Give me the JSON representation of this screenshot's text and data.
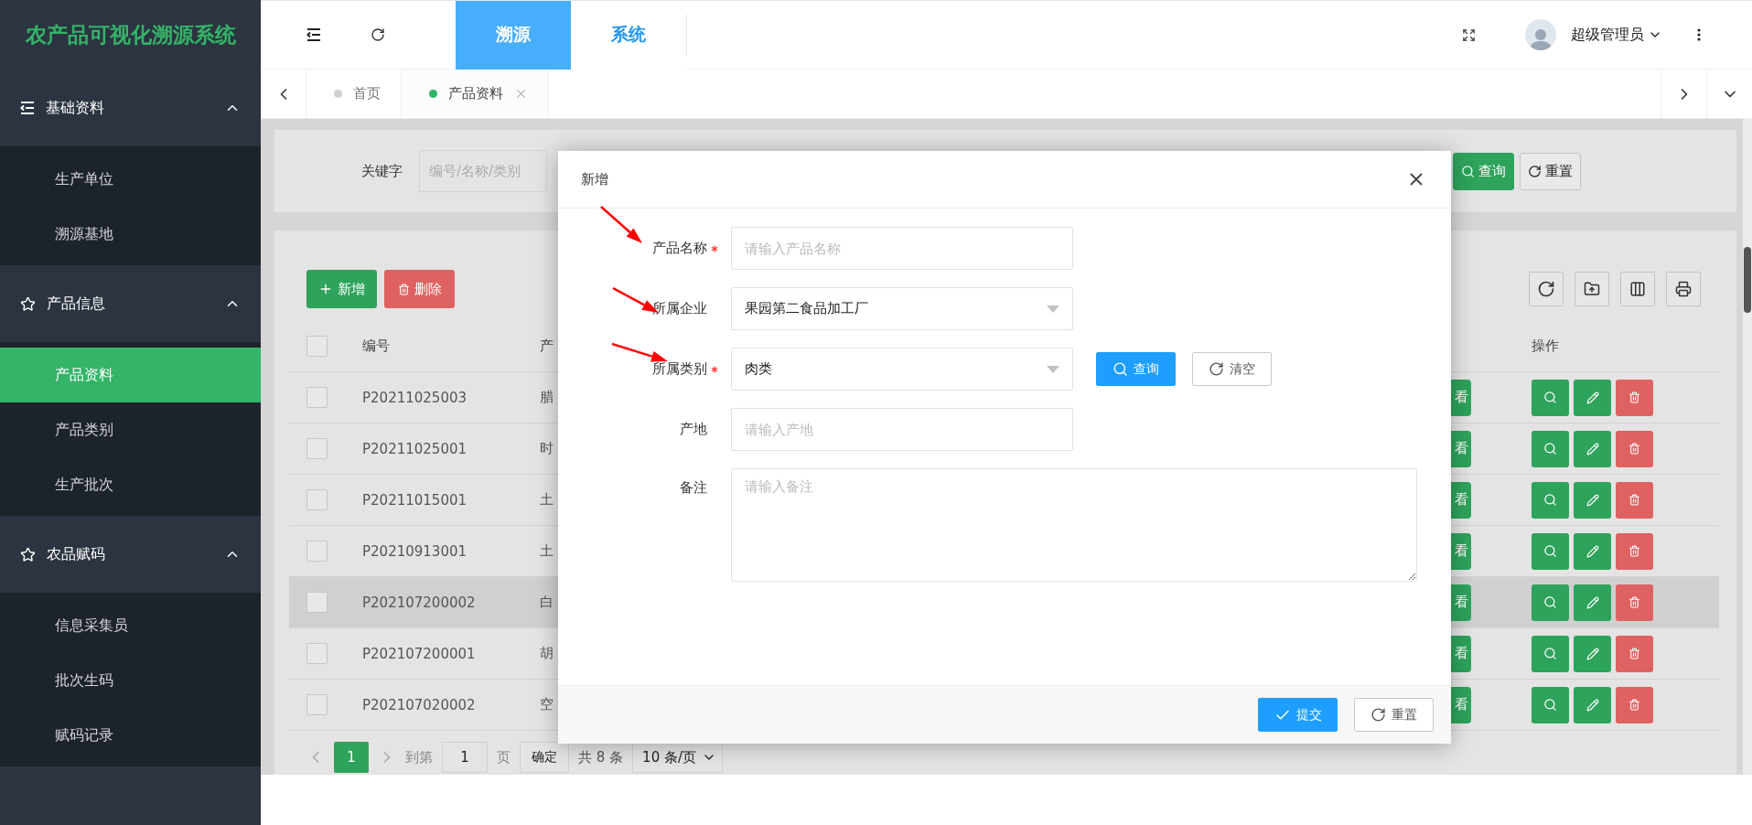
{
  "sidebar": {
    "title": "农产品可视化溯源系统",
    "groups": [
      {
        "label": "基础资料",
        "kind": "list",
        "expanded": true,
        "items": [
          {
            "label": "生产单位",
            "selected": false
          },
          {
            "label": "溯源基地",
            "selected": false
          }
        ]
      },
      {
        "label": "产品信息",
        "kind": "star",
        "expanded": true,
        "items": [
          {
            "label": "产品资料",
            "selected": true
          },
          {
            "label": "产品类别",
            "selected": false
          },
          {
            "label": "生产批次",
            "selected": false
          }
        ]
      },
      {
        "label": "农品赋码",
        "kind": "star",
        "expanded": true,
        "items": [
          {
            "label": "信息采集员",
            "selected": false
          },
          {
            "label": "批次生码",
            "selected": false
          },
          {
            "label": "赋码记录",
            "selected": false
          }
        ]
      }
    ]
  },
  "header": {
    "nav_tabs": [
      {
        "label": "溯源",
        "selected": true
      },
      {
        "label": "系统",
        "selected": false
      }
    ],
    "user": {
      "name": "超级管理员"
    }
  },
  "tabs": [
    {
      "label": "首页",
      "selected": false,
      "closable": false
    },
    {
      "label": "产品资料",
      "selected": true,
      "closable": true
    }
  ],
  "search": {
    "label": "关键字",
    "placeholder": "编号/名称/类别",
    "buttons": [
      {
        "label": "查询",
        "kind": "search"
      },
      {
        "label": "重置",
        "kind": "reset"
      }
    ]
  },
  "toolbar": {
    "buttons": [
      {
        "label": "新增",
        "kind": "add"
      },
      {
        "label": "删除",
        "kind": "delete"
      }
    ]
  },
  "table": {
    "columns": [
      "编号",
      "产",
      "操作"
    ],
    "header_checked": false,
    "rows": [
      {
        "code": "P20211025003",
        "name": "腊",
        "view": "看",
        "checked": false,
        "hovered": false
      },
      {
        "code": "P20211025001",
        "name": "时",
        "view": "看",
        "checked": false,
        "hovered": false
      },
      {
        "code": "P20211015001",
        "name": "土",
        "view": "看",
        "checked": false,
        "hovered": false
      },
      {
        "code": "P20210913001",
        "name": "土",
        "view": "看",
        "checked": false,
        "hovered": false
      },
      {
        "code": "P202107200002",
        "name": "白",
        "view": "看",
        "checked": false,
        "hovered": true
      },
      {
        "code": "P202107200001",
        "name": "胡",
        "view": "看",
        "checked": false,
        "hovered": false
      },
      {
        "code": "P202107020002",
        "name": "空",
        "view": "看",
        "checked": false,
        "hovered": false
      }
    ]
  },
  "pagination": {
    "pages": [
      {
        "label": "1",
        "selected": true
      }
    ],
    "goto_label": "到第",
    "goto_value": "1",
    "page_unit": "页",
    "confirm": "确定",
    "total": "共 8 条",
    "page_size": "10 条/页"
  },
  "modal": {
    "title": "新增",
    "fields": [
      {
        "label": "产品名称",
        "kind": "text",
        "required": true,
        "placeholder": "请输入产品名称"
      },
      {
        "label": "所属企业",
        "kind": "select",
        "required": false,
        "value": "果园第二食品加工厂"
      },
      {
        "label": "所属类别",
        "kind": "select",
        "required": true,
        "value": "肉类",
        "buttons": [
          {
            "label": "查询",
            "kind": "search"
          },
          {
            "label": "清空",
            "kind": "clear"
          }
        ]
      },
      {
        "label": "产地",
        "kind": "text",
        "required": false,
        "placeholder": "请输入产地"
      },
      {
        "label": "备注",
        "kind": "textarea",
        "required": false,
        "placeholder": "请输入备注"
      }
    ],
    "buttons": [
      {
        "label": "提交",
        "kind": "submit"
      },
      {
        "label": "重置",
        "kind": "reset"
      }
    ]
  }
}
